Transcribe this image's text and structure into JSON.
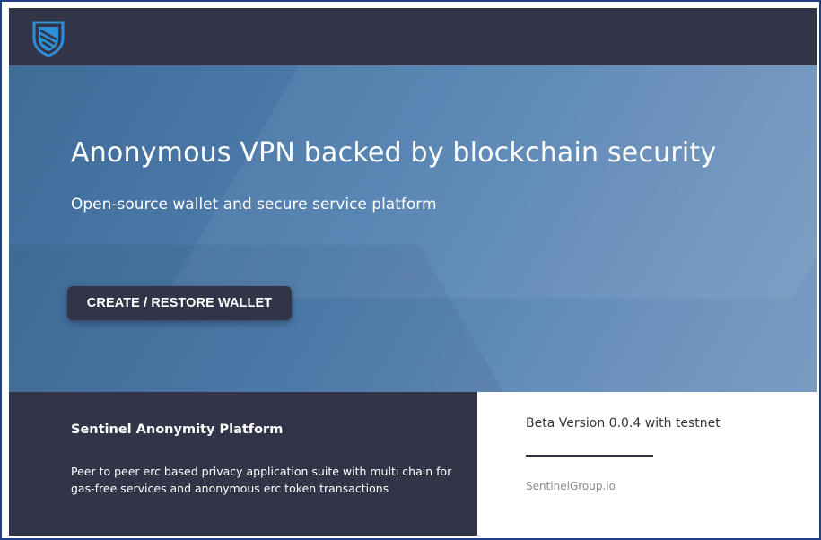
{
  "header": {
    "logo_icon": "shield-icon"
  },
  "hero": {
    "title": "Anonymous VPN backed by blockchain security",
    "subtitle": "Open-source wallet and secure service platform",
    "cta_label": "CREATE / RESTORE WALLET"
  },
  "footer": {
    "heading": "Sentinel Anonymity Platform",
    "description": "Peer to peer erc based privacy application suite with multi chain for gas-free services and anonymous erc token transactions",
    "version": "Beta Version 0.0.4 with testnet",
    "site_link": "SentinelGroup.io"
  },
  "colors": {
    "dark_navy": "#323448",
    "hero_blue": "#4f7fb0",
    "logo_blue": "#2f8fd6"
  }
}
